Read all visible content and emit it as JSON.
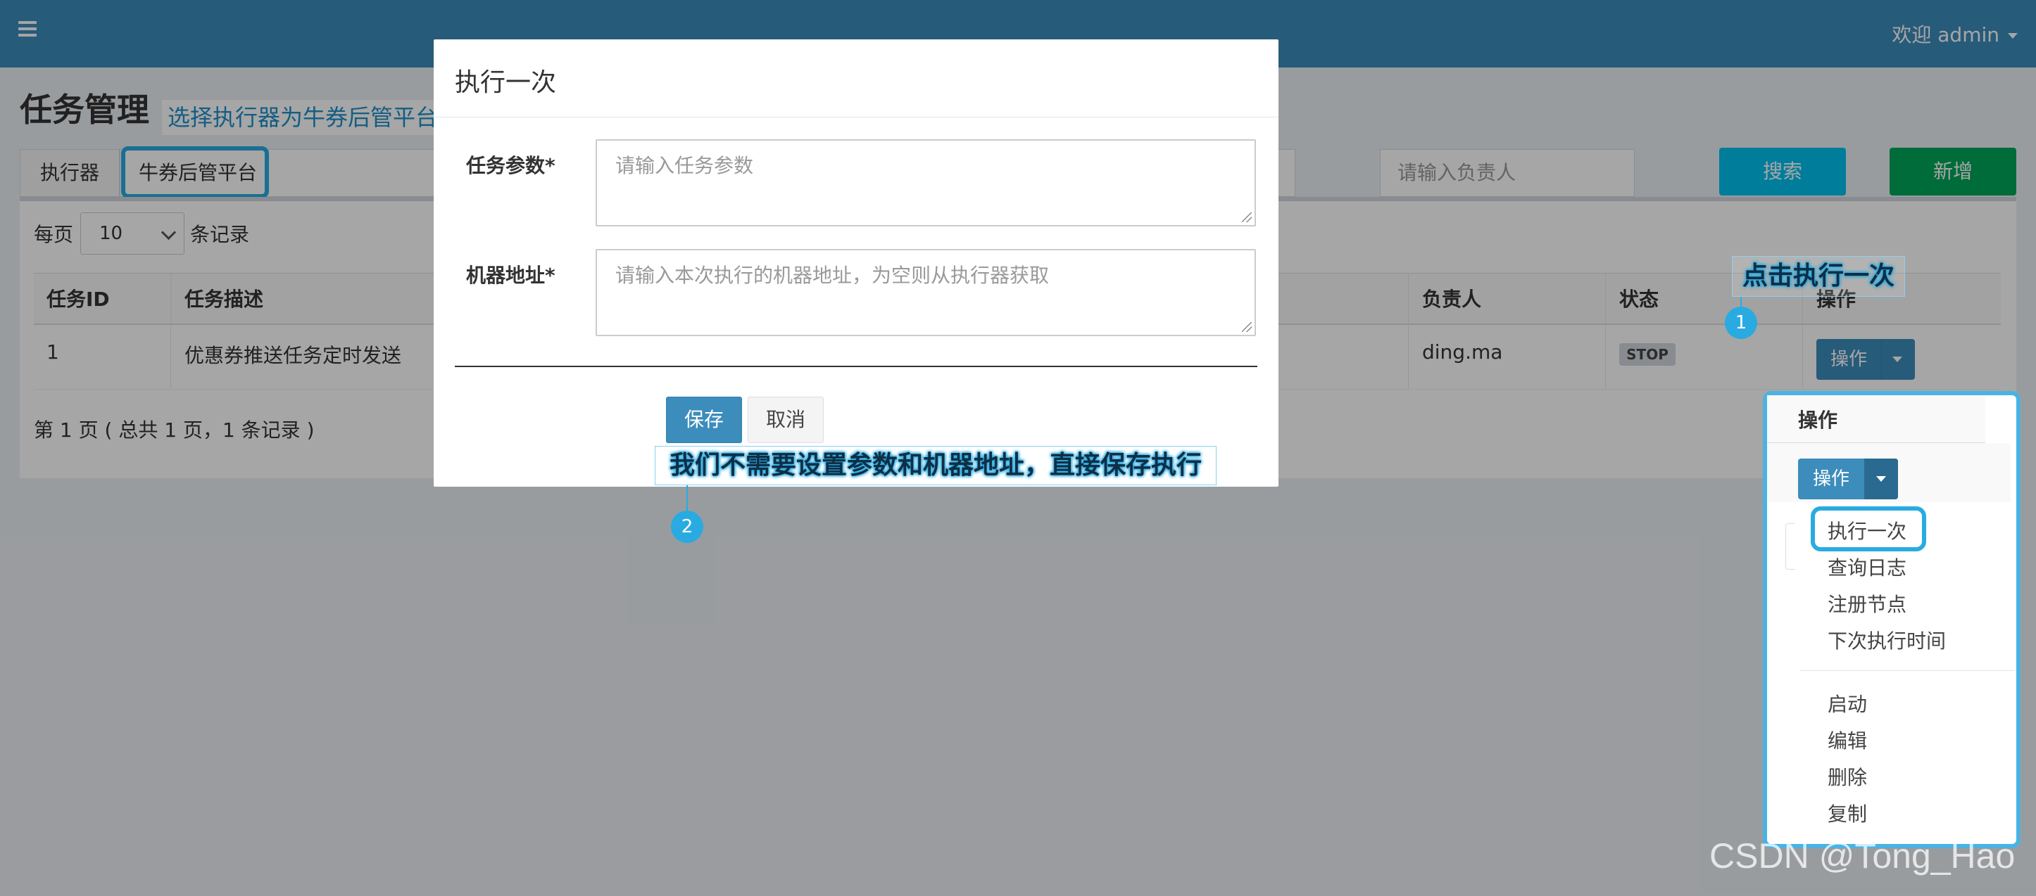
{
  "header": {
    "welcome": "欢迎 admin"
  },
  "page": {
    "title": "任务管理"
  },
  "annotations": {
    "top_callout": "选择执行器为牛券后管平台",
    "callout_1": "点击执行一次",
    "callout_1_num": "1",
    "callout_2": "我们不需要设置参数和机器地址，直接保存执行",
    "callout_2_num": "2"
  },
  "filters": {
    "executor_label": "执行器",
    "executor_value": "牛券后管平台",
    "author_placeholder": "请输入负责人",
    "search_label": "搜索",
    "add_label": "新增"
  },
  "table": {
    "per_page_prefix": "每页",
    "per_page_value": "10",
    "per_page_suffix": "条记录",
    "columns": [
      "任务ID",
      "任务描述",
      "负责人",
      "状态",
      "操作"
    ],
    "rows": [
      {
        "id": "1",
        "desc": "优惠券推送任务定时发送",
        "author": "ding.ma",
        "status": "STOP",
        "op": "操作"
      }
    ],
    "pagination": "第 1 页 ( 总共 1 页，1 条记录 )"
  },
  "modal": {
    "title": "执行一次",
    "param_label": "任务参数*",
    "param_placeholder": "请输入任务参数",
    "address_label": "机器地址*",
    "address_placeholder": "请输入本次执行的机器地址，为空则从执行器获取",
    "save": "保存",
    "cancel": "取消"
  },
  "inset": {
    "header": "操作",
    "button": "操作",
    "menu": [
      "执行一次",
      "查询日志",
      "注册节点",
      "下次执行时间",
      "启动",
      "编辑",
      "删除",
      "复制"
    ]
  },
  "watermark": "CSDN @Tong_Hao",
  "colors": {
    "header": "#3c8dbc",
    "accent": "#29abe2",
    "success": "#00a65a",
    "info": "#00c0ef"
  }
}
